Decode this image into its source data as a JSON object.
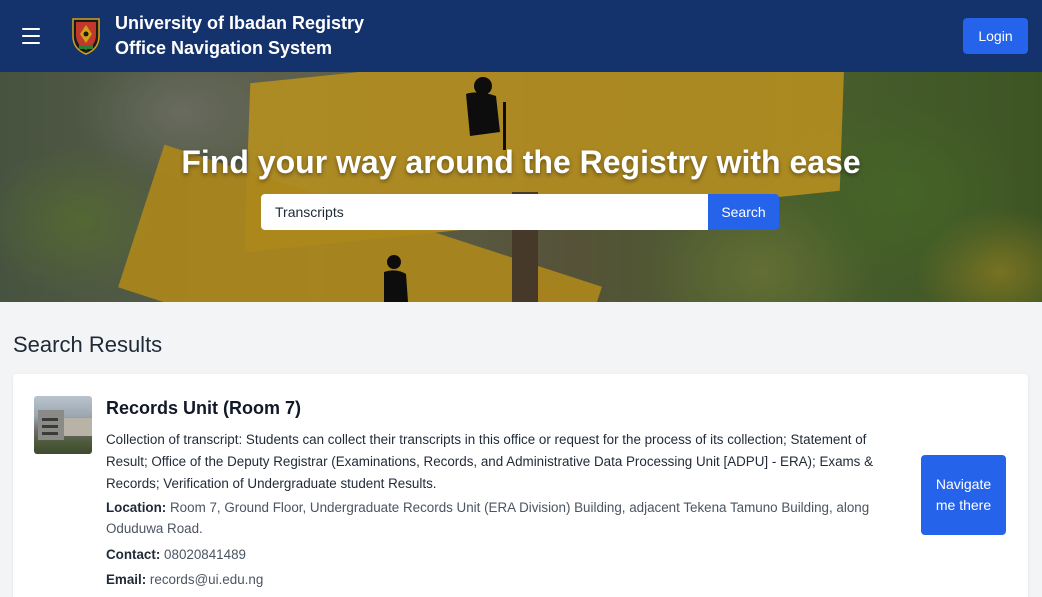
{
  "header": {
    "brand_line1": "University of Ibadan Registry",
    "brand_line2": "Office Navigation System",
    "login_label": "Login"
  },
  "hero": {
    "title": "Find your way around the Registry with ease",
    "search": {
      "value": "Transcripts",
      "button_label": "Search"
    }
  },
  "results": {
    "heading": "Search Results",
    "items": [
      {
        "title": "Records Unit (Room 7)",
        "description": "Collection of transcript: Students can collect their transcripts in this office or request for the process of its collection; Statement of Result; Office of the Deputy Registrar (Examinations, Records, and Administrative Data Processing Unit [ADPU] - ERA); Exams & Records; Verification of Undergraduate student Results.",
        "location_label": "Location:",
        "location": "Room 7, Ground Floor, Undergraduate Records Unit (ERA Division) Building, adjacent Tekena Tamuno Building, along Oduduwa Road.",
        "contact_label": "Contact:",
        "contact": "08020841489",
        "email_label": "Email:",
        "email": "records@ui.edu.ng",
        "navigate_label": "Navigate me there"
      }
    ]
  },
  "colors": {
    "navbar": "#14326c",
    "accent": "#2563eb"
  }
}
